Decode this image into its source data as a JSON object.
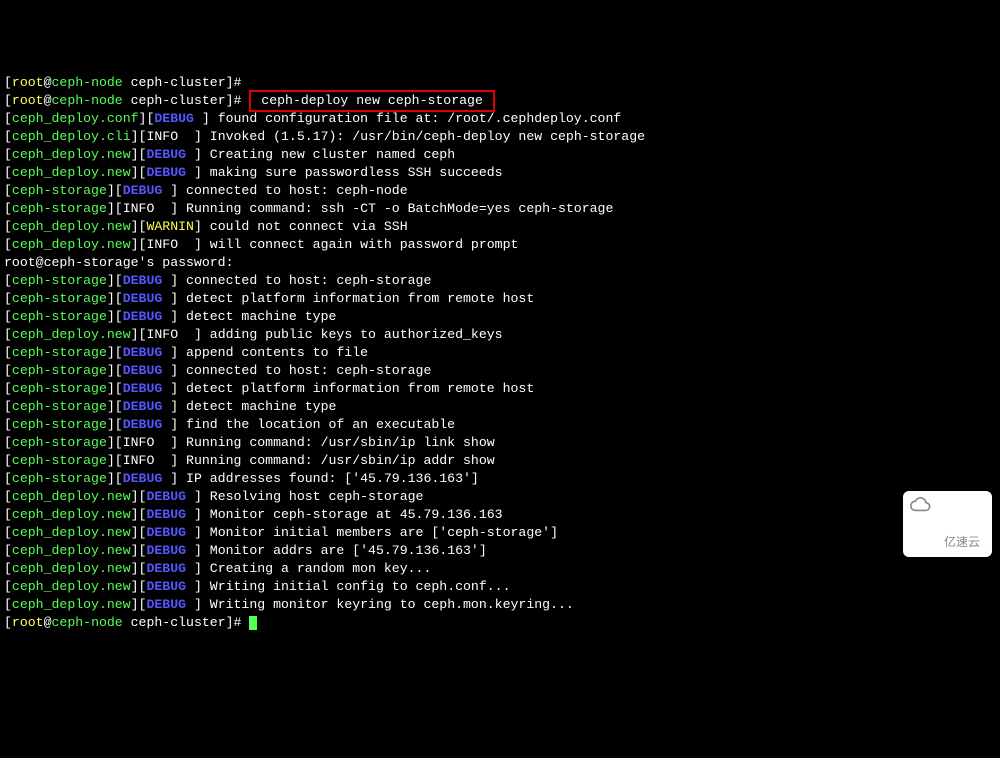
{
  "prompt": {
    "user": "root",
    "host": "ceph-node",
    "cwd": "ceph-cluster",
    "symbol": "#"
  },
  "command": "ceph-deploy new ceph-storage",
  "ssh_prompt": "root@ceph-storage's password:",
  "lines": [
    {
      "module": "ceph_deploy.conf",
      "level": "DEBUG",
      "msg": "found configuration file at: /root/.cephdeploy.conf"
    },
    {
      "module": "ceph_deploy.cli",
      "level": "INFO",
      "msg": "Invoked (1.5.17): /usr/bin/ceph-deploy new ceph-storage"
    },
    {
      "module": "ceph_deploy.new",
      "level": "DEBUG",
      "msg": "Creating new cluster named ceph"
    },
    {
      "module": "ceph_deploy.new",
      "level": "DEBUG",
      "msg": "making sure passwordless SSH succeeds"
    },
    {
      "module": "ceph-storage",
      "level": "DEBUG",
      "msg": "connected to host: ceph-node"
    },
    {
      "module": "ceph-storage",
      "level": "INFO",
      "msg": "Running command: ssh -CT -o BatchMode=yes ceph-storage"
    },
    {
      "module": "ceph_deploy.new",
      "level": "WARNIN",
      "msg": "could not connect via SSH"
    },
    {
      "module": "ceph_deploy.new",
      "level": "INFO",
      "msg": "will connect again with password prompt"
    },
    {
      "module": "ceph-storage",
      "level": "DEBUG",
      "msg": "connected to host: ceph-storage"
    },
    {
      "module": "ceph-storage",
      "level": "DEBUG",
      "msg": "detect platform information from remote host"
    },
    {
      "module": "ceph-storage",
      "level": "DEBUG",
      "msg": "detect machine type"
    },
    {
      "module": "ceph_deploy.new",
      "level": "INFO",
      "msg": "adding public keys to authorized_keys"
    },
    {
      "module": "ceph-storage",
      "level": "DEBUG",
      "msg": "append contents to file"
    },
    {
      "module": "ceph-storage",
      "level": "DEBUG",
      "msg": "connected to host: ceph-storage"
    },
    {
      "module": "ceph-storage",
      "level": "DEBUG",
      "msg": "detect platform information from remote host"
    },
    {
      "module": "ceph-storage",
      "level": "DEBUG",
      "msg": "detect machine type"
    },
    {
      "module": "ceph-storage",
      "level": "DEBUG",
      "msg": "find the location of an executable"
    },
    {
      "module": "ceph-storage",
      "level": "INFO",
      "msg": "Running command: /usr/sbin/ip link show"
    },
    {
      "module": "ceph-storage",
      "level": "INFO",
      "msg": "Running command: /usr/sbin/ip addr show"
    },
    {
      "module": "ceph-storage",
      "level": "DEBUG",
      "msg": "IP addresses found: ['45.79.136.163']"
    },
    {
      "module": "ceph_deploy.new",
      "level": "DEBUG",
      "msg": "Resolving host ceph-storage"
    },
    {
      "module": "ceph_deploy.new",
      "level": "DEBUG",
      "msg": "Monitor ceph-storage at 45.79.136.163"
    },
    {
      "module": "ceph_deploy.new",
      "level": "DEBUG",
      "msg": "Monitor initial members are ['ceph-storage']"
    },
    {
      "module": "ceph_deploy.new",
      "level": "DEBUG",
      "msg": "Monitor addrs are ['45.79.136.163']"
    },
    {
      "module": "ceph_deploy.new",
      "level": "DEBUG",
      "msg": "Creating a random mon key..."
    },
    {
      "module": "ceph_deploy.new",
      "level": "DEBUG",
      "msg": "Writing initial config to ceph.conf..."
    },
    {
      "module": "ceph_deploy.new",
      "level": "DEBUG",
      "msg": "Writing monitor keyring to ceph.mon.keyring..."
    }
  ],
  "watermark": "亿速云"
}
